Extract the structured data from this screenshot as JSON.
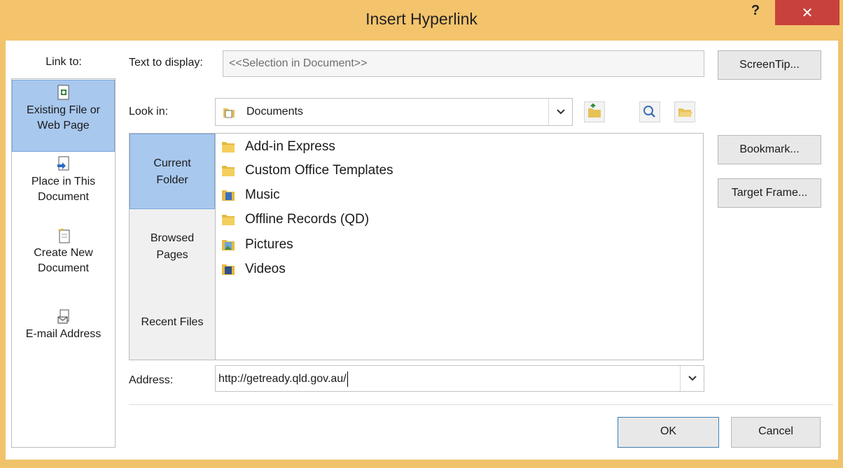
{
  "window": {
    "title": "Insert Hyperlink",
    "help": "?",
    "close": "✕"
  },
  "colors": {
    "title_bar": "#f3c46c",
    "close_button": "#c8413c",
    "selection": "#a8c8ee"
  },
  "link_to": {
    "label": "Link to:",
    "items": [
      {
        "line1": "Existing File or",
        "line2": "Web Page",
        "icon": "existing-file-icon",
        "selected": true
      },
      {
        "line1": "Place in This",
        "line2": "Document",
        "icon": "place-in-document-icon",
        "selected": false
      },
      {
        "line1": "Create New",
        "line2": "Document",
        "icon": "new-document-icon",
        "selected": false
      },
      {
        "line1": "E-mail Address",
        "line2": "",
        "icon": "email-address-icon",
        "selected": false
      }
    ]
  },
  "text_to_display": {
    "label": "Text to display:",
    "value": "<<Selection in Document>>"
  },
  "buttons": {
    "screentip": "ScreenTip...",
    "bookmark": "Bookmark...",
    "target_frame": "Target Frame...",
    "ok": "OK",
    "cancel": "Cancel"
  },
  "look_in": {
    "label": "Look in:",
    "value": "Documents"
  },
  "nav": {
    "current_folder": {
      "line1": "Current",
      "line2": "Folder"
    },
    "browsed_pages": {
      "line1": "Browsed",
      "line2": "Pages"
    },
    "recent_files": "Recent Files"
  },
  "files": [
    {
      "name": "Add-in Express",
      "icon": "folder-icon"
    },
    {
      "name": "Custom Office Templates",
      "icon": "folder-icon"
    },
    {
      "name": "Music",
      "icon": "music-folder-icon"
    },
    {
      "name": "Offline Records (QD)",
      "icon": "folder-icon"
    },
    {
      "name": "Pictures",
      "icon": "pictures-folder-icon"
    },
    {
      "name": "Videos",
      "icon": "videos-folder-icon"
    }
  ],
  "address": {
    "label": "Address:",
    "value": "http://getready.qld.gov.au/"
  }
}
